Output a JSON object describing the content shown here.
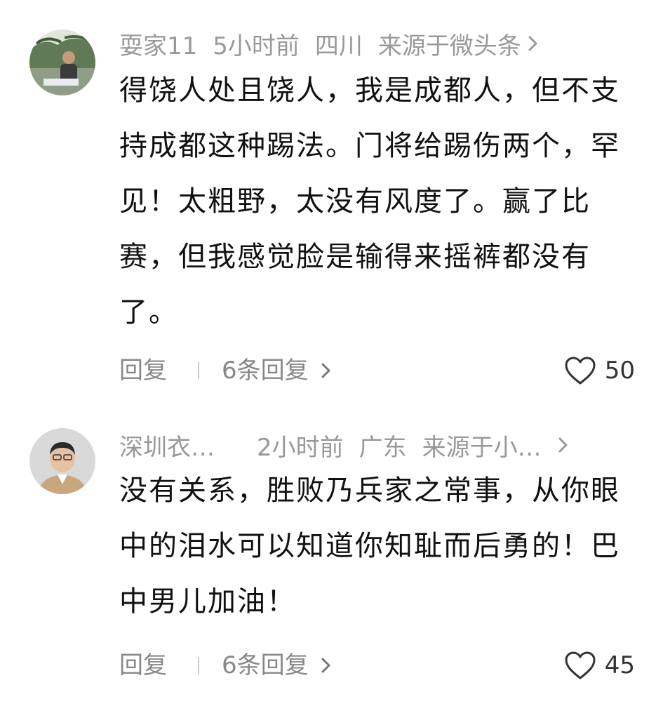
{
  "comments": [
    {
      "username": "耍家11",
      "time": "5小时前",
      "location": "四川",
      "source": "来源于微头条",
      "text": "得饶人处且饶人，我是成都人，但不支持成都这种踢法。门将给踢伤两个，罕见！太粗野，太没有风度了。赢了比赛，但我感觉脸是输得来摇裤都没有了。",
      "reply_label": "回复",
      "replies_label": "6条回复",
      "likes": "50"
    },
    {
      "username": "深圳衣…",
      "time": "2小时前",
      "location": "广东",
      "source": "来源于小…",
      "text": "没有关系，胜败乃兵家之常事，从你眼中的泪水可以知道你知耻而后勇的！巴中男儿加油！",
      "reply_label": "回复",
      "replies_label": "6条回复",
      "likes": "45"
    }
  ],
  "icons": {
    "chevron": "chevron-right-icon",
    "like": "heart-outline-icon"
  }
}
